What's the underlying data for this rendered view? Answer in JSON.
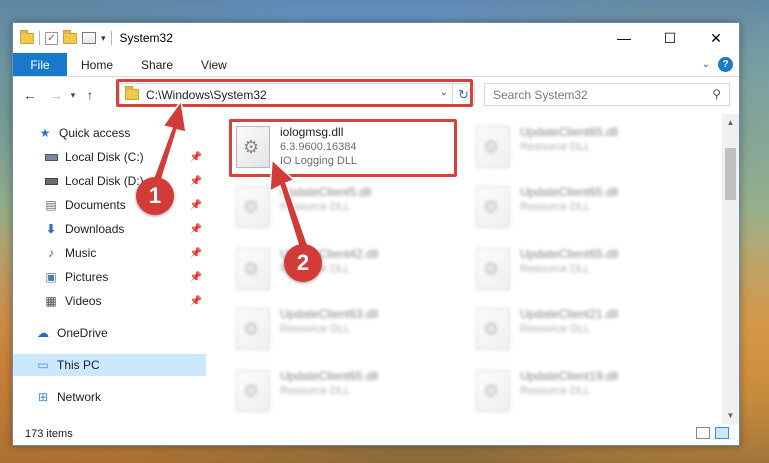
{
  "window": {
    "title": "System32"
  },
  "ribbon": {
    "tabs": [
      "File",
      "Home",
      "Share",
      "View"
    ]
  },
  "address": {
    "path": "C:\\Windows\\System32"
  },
  "search": {
    "placeholder": "Search System32"
  },
  "sidebar": {
    "items": [
      {
        "label": "Quick access",
        "icon": "star-icon",
        "pinned": false
      },
      {
        "label": "Local Disk (C:)",
        "icon": "drive-icon",
        "pinned": true
      },
      {
        "label": "Local Disk (D:)",
        "icon": "drive-icon",
        "pinned": true
      },
      {
        "label": "Documents",
        "icon": "documents-icon",
        "pinned": true
      },
      {
        "label": "Downloads",
        "icon": "download-icon",
        "pinned": true
      },
      {
        "label": "Music",
        "icon": "music-icon",
        "pinned": true
      },
      {
        "label": "Pictures",
        "icon": "pictures-icon",
        "pinned": true
      },
      {
        "label": "Videos",
        "icon": "videos-icon",
        "pinned": true
      },
      {
        "label": "OneDrive",
        "icon": "cloud-icon",
        "pinned": false
      },
      {
        "label": "This PC",
        "icon": "computer-icon",
        "pinned": false,
        "selected": true
      },
      {
        "label": "Network",
        "icon": "network-icon",
        "pinned": false
      }
    ]
  },
  "files": {
    "highlighted": {
      "name": "iologmsg.dll",
      "version": "6.3.9600.16384",
      "description": "IO Logging DLL"
    },
    "left_column": [
      {
        "name": "UpdateClient5.dll",
        "description": "Resource DLL"
      },
      {
        "name": "UpdateClient42.dll",
        "description": "Resource DLL"
      },
      {
        "name": "UpdateClient63.dll",
        "description": "Resource DLL"
      },
      {
        "name": "UpdateClient65.dll",
        "description": "Resource DLL"
      }
    ],
    "right_column": [
      {
        "name": "UpdateClient65.dll",
        "description": "Resource DLL"
      },
      {
        "name": "UpdateClient65.dll",
        "description": "Resource DLL"
      },
      {
        "name": "UpdateClient65.dll",
        "description": "Resource DLL"
      },
      {
        "name": "UpdateClient21.dll",
        "description": "Resource DLL"
      },
      {
        "name": "UpdateClient19.dll",
        "description": "Resource DLL"
      }
    ]
  },
  "status": {
    "item_count": "173 items"
  },
  "annotations": {
    "step1": "1",
    "step2": "2",
    "color": "#d23b37"
  }
}
